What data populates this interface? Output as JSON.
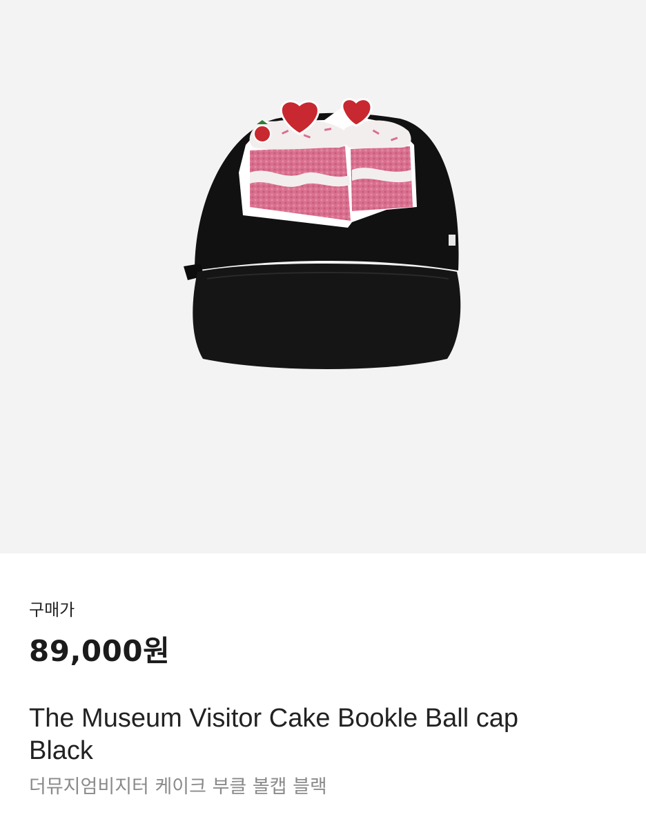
{
  "product": {
    "image_icon": "cake-ball-cap-image",
    "price_label": "구매가",
    "price": "89,000원",
    "title": "The Museum Visitor Cake Bookle Ball cap Black",
    "subtitle": "더뮤지엄비지터 케이크 부클 볼캡 블랙"
  },
  "colors": {
    "image_background": "#f3f3f3",
    "cap": "#111111",
    "cake_pink": "#d9708f",
    "cream": "#f3eeee",
    "strawberry": "#c8282f",
    "price_text": "#1b1b1b",
    "subtitle_text": "#8a8a8a"
  }
}
